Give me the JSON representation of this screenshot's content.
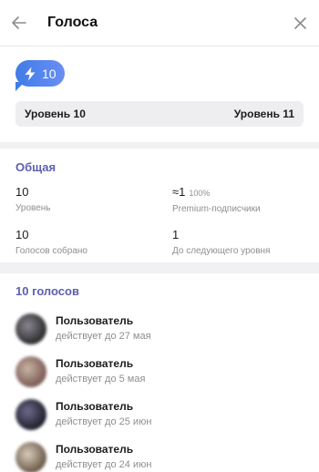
{
  "header": {
    "title": "Голоса",
    "back_icon": "arrow-left-icon",
    "close_icon": "close-icon"
  },
  "boost": {
    "badge_value": "10",
    "icon": "lightning-icon",
    "current_level": "Уровень 10",
    "next_level": "Уровень 11",
    "accent_start": "#3f7ce8",
    "accent_end": "#6a8ef3"
  },
  "overview": {
    "title": "Общая",
    "level_value": "10",
    "level_label": "Уровень",
    "premium_value": "≈1",
    "premium_percent": "100%",
    "premium_label": "Premium-подписчики",
    "collected_value": "10",
    "collected_label": "Голосов собрано",
    "next_value": "1",
    "next_label": "До следующего уровня"
  },
  "boosters": {
    "title": "10 голосов",
    "items": [
      {
        "name": "Пользователь",
        "expires": "действует до 27 мая",
        "avatar_colors": [
          "#2b2b2d",
          "#8a8790"
        ]
      },
      {
        "name": "Пользователь",
        "expires": "действует до 5 мая",
        "avatar_colors": [
          "#7b5a55",
          "#c8b4a4"
        ]
      },
      {
        "name": "Пользователь",
        "expires": "действует до 25 июн",
        "avatar_colors": [
          "#1e1e2a",
          "#6d6a8a"
        ]
      },
      {
        "name": "Пользователь",
        "expires": "действует до 24 июн",
        "avatar_colors": [
          "#6b5a48",
          "#d9cbbb"
        ]
      }
    ]
  },
  "colors": {
    "section_title": "#5d5fb0",
    "muted_text": "#8e8e93",
    "divider_bg": "#f1f1f4"
  }
}
